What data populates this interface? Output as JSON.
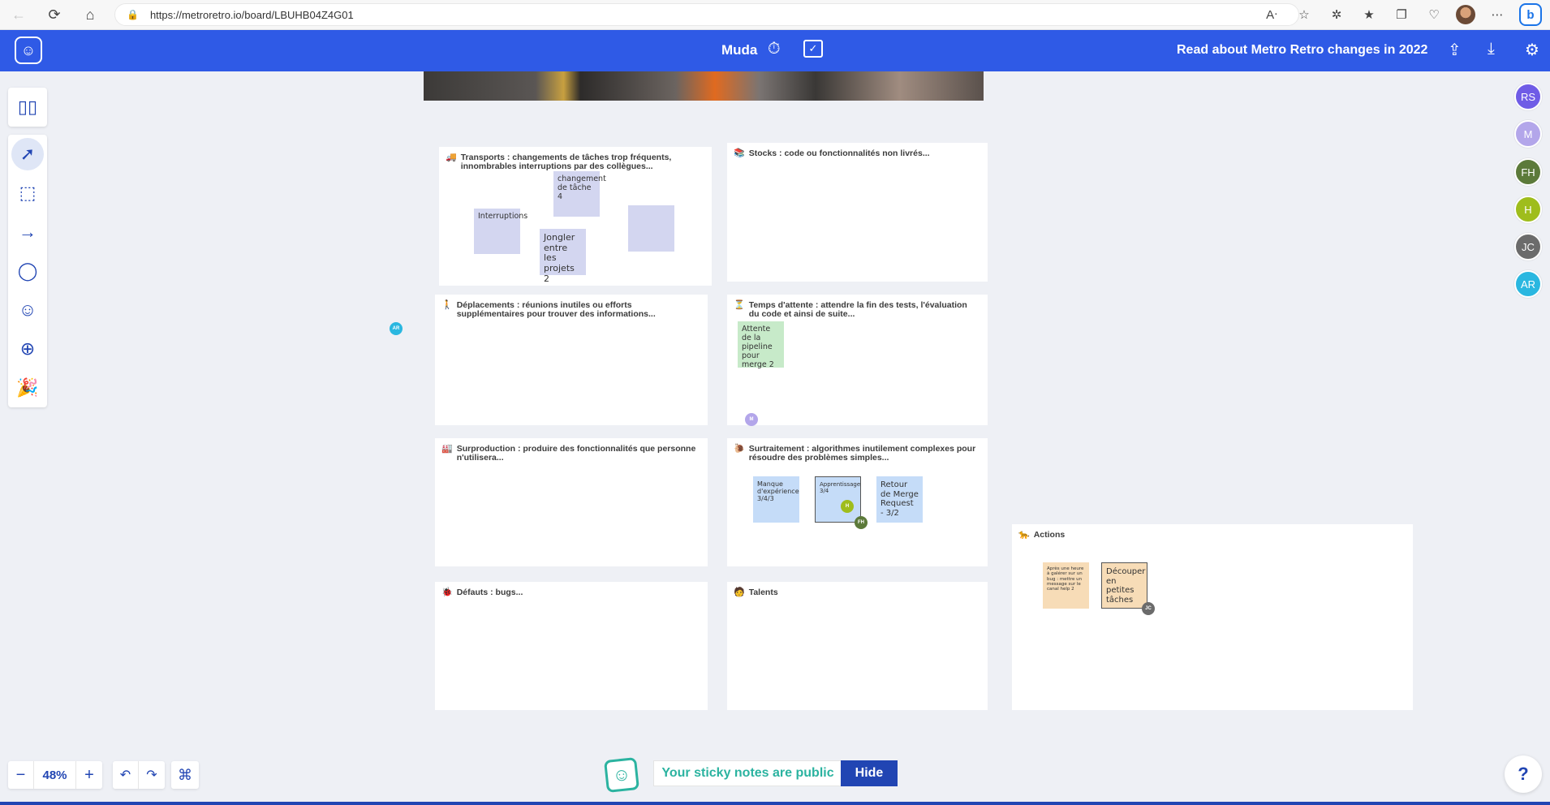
{
  "browser": {
    "url": "https://metroretro.io/board/LBUHB04Z4G01",
    "back_icon": "arrow-left",
    "refresh_icon": "refresh",
    "home_icon": "home",
    "lock_icon": "lock"
  },
  "header": {
    "board_title": "Muda",
    "news_link": "Read about Metro Retro changes in 2022",
    "accent_color": "#2f5ae6"
  },
  "columns": [
    {
      "title": "Transports : changements de tâches trop fréquents, innombrables interruptions par des collègues...",
      "emoji": "🚚",
      "stickies": [
        {
          "text": "changement de tâche 4",
          "color": "lavender"
        },
        {
          "text": "Interruptions",
          "color": "lavender"
        },
        {
          "text": "Jongler entre les projets 2",
          "color": "lavender"
        },
        {
          "text": "",
          "color": "lavender"
        }
      ]
    },
    {
      "title": "Stocks : code ou fonctionnalités non livrés...",
      "emoji": "📚",
      "stickies": []
    },
    {
      "title": "Déplacements : réunions inutiles ou efforts supplémentaires pour trouver des informations...",
      "emoji": "🚶",
      "stickies": []
    },
    {
      "title": "Temps d'attente : attendre la fin des tests, l'évaluation du code et ainsi de suite...",
      "emoji": "⏳",
      "stickies": [
        {
          "text": "Attente de la pipeline pour merge 2",
          "color": "green"
        }
      ],
      "avatar": "M"
    },
    {
      "title": "Surproduction : produire des fonctionnalités que personne n'utilisera...",
      "emoji": "🏭",
      "stickies": []
    },
    {
      "title": "Surtraitement : algorithmes inutilement complexes pour résoudre des problèmes simples...",
      "emoji": "🐌",
      "stickies": [
        {
          "text": "Manque d'expérience 3/4/3",
          "color": "blue"
        },
        {
          "text": "Apprentissage 3/4",
          "color": "blue",
          "avatar": "H",
          "avatar2": "FH"
        },
        {
          "text": "Retour de Merge Request - 3/2",
          "color": "blue"
        }
      ]
    },
    {
      "title": "Défauts : bugs...",
      "emoji": "🐞",
      "stickies": []
    },
    {
      "title": "Talents",
      "emoji": "🧑",
      "stickies": []
    },
    {
      "title": "Actions",
      "emoji": "🐆",
      "stickies": [
        {
          "text": "Après une heure à galérer sur un bug : mettre un message sur le canal help 2",
          "color": "orange"
        },
        {
          "text": "Découper en petites tâches",
          "color": "orange",
          "avatar": "JC"
        }
      ]
    }
  ],
  "users": [
    {
      "initials": "RS",
      "color": "#6f5ce6"
    },
    {
      "initials": "M",
      "color": "#b3a6ea"
    },
    {
      "initials": "FH",
      "color": "#5c7a3a"
    },
    {
      "initials": "H",
      "color": "#9fbd1c"
    },
    {
      "initials": "JC",
      "color": "#6b6b6b"
    },
    {
      "initials": "AR",
      "color": "#2ab7e0"
    }
  ],
  "cursor_avatar": "AR",
  "zoom": {
    "value": "48%"
  },
  "public_notice": {
    "text": "Your sticky notes are public",
    "hide_label": "Hide"
  },
  "help_label": "?"
}
